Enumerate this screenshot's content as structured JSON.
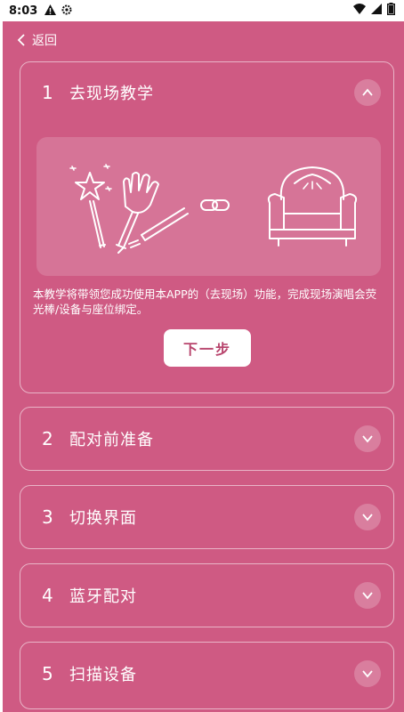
{
  "status_bar": {
    "time": "8:03",
    "icons": [
      "warning-icon",
      "settings-icon",
      "wifi-icon",
      "signal-icon",
      "battery-icon"
    ]
  },
  "nav": {
    "back_label": "返回"
  },
  "colors": {
    "background": "#cf5a83",
    "button_text": "#b8456d"
  },
  "steps": [
    {
      "number": "1",
      "title": "去现场教学",
      "expanded": true,
      "description": "本教学将带领您成功使用本APP的（去现场）功能，完成现场演唱会荧光棒/设备与座位绑定。",
      "illustration_icons": [
        "magic-wand-icon",
        "glow-stick-icon",
        "link-icon",
        "seat-icon"
      ],
      "button_label": "下一步"
    },
    {
      "number": "2",
      "title": "配对前准备",
      "expanded": false
    },
    {
      "number": "3",
      "title": "切换界面",
      "expanded": false
    },
    {
      "number": "4",
      "title": "蓝牙配对",
      "expanded": false
    },
    {
      "number": "5",
      "title": "扫描设备",
      "expanded": false
    }
  ]
}
